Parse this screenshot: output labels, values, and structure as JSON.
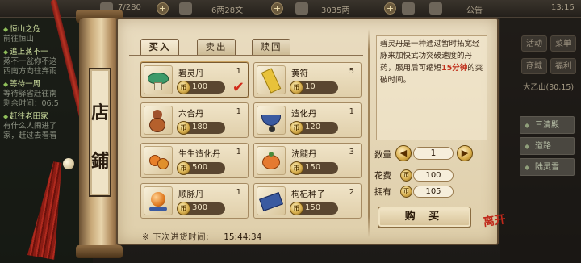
{
  "hud": {
    "stamina": "7/280",
    "money": "6两28文",
    "ingots": "3035两",
    "announcement": "公告",
    "clock": "13:15"
  },
  "quest_log": [
    {
      "title": "恒山之危",
      "sub": "前往恒山"
    },
    {
      "title": "追上蒸不一",
      "sub": "蒸不一瓮你不这"
    },
    {
      "title": "",
      "sub": "西南方向往弃雨"
    },
    {
      "title": "等待一周",
      "sub": "等待驿省赶往南"
    },
    {
      "title": "",
      "sub": "剩余时间：06:5"
    },
    {
      "title": "赶往老田家",
      "sub": "有什么人闹进了"
    },
    {
      "title": "",
      "sub": "家，赶过去看看"
    }
  ],
  "right_menu": {
    "buttons": [
      "活动",
      "菜单",
      "商城",
      "福利"
    ],
    "location": "大乙山",
    "location_coords": "(30,15)",
    "side_items": [
      "三清殿",
      "道路",
      "陆灵雪"
    ]
  },
  "shop_sign": [
    "店",
    "鋪"
  ],
  "tabs": [
    "买入",
    "卖出",
    "赎回"
  ],
  "items": [
    {
      "name": "碧灵丹",
      "qty": "1",
      "price": "100",
      "icon": "green-mushroom-icon",
      "selected": true
    },
    {
      "name": "黄符",
      "qty": "5",
      "price": "10",
      "icon": "yellow-talisman-icon",
      "selected": false
    },
    {
      "name": "六合丹",
      "qty": "1",
      "price": "180",
      "icon": "gourd-pill-icon",
      "selected": false
    },
    {
      "name": "造化丹",
      "qty": "1",
      "price": "120",
      "icon": "blue-bowl-icon",
      "selected": false
    },
    {
      "name": "生生造化丹",
      "qty": "1",
      "price": "500",
      "icon": "orange-pills-icon",
      "selected": false
    },
    {
      "name": "洗髓丹",
      "qty": "3",
      "price": "150",
      "icon": "orange-fruit-icon",
      "selected": false
    },
    {
      "name": "顺脉丹",
      "qty": "1",
      "price": "300",
      "icon": "orange-orb-icon",
      "selected": false
    },
    {
      "name": "枸杞种子",
      "qty": "2",
      "price": "150",
      "icon": "seed-packet-icon",
      "selected": false
    }
  ],
  "coin_glyph": "币",
  "restock": {
    "label": "※ 下次进货时间:",
    "time": "15:44:34"
  },
  "description": {
    "text_before": "碧灵丹是一种通过暂时拓宽经脉来加快武功突破速度的丹药，服用后可缩短",
    "highlight": "15分钟",
    "text_after": "的突破时间。"
  },
  "purchase": {
    "qty_label": "数量",
    "qty_value": "1",
    "cost_label": "花费",
    "cost_value": "100",
    "owned_label": "拥有",
    "owned_value": "105",
    "buy_label": "购 买",
    "minus": "◀",
    "plus": "▶"
  },
  "close_label": "离开"
}
